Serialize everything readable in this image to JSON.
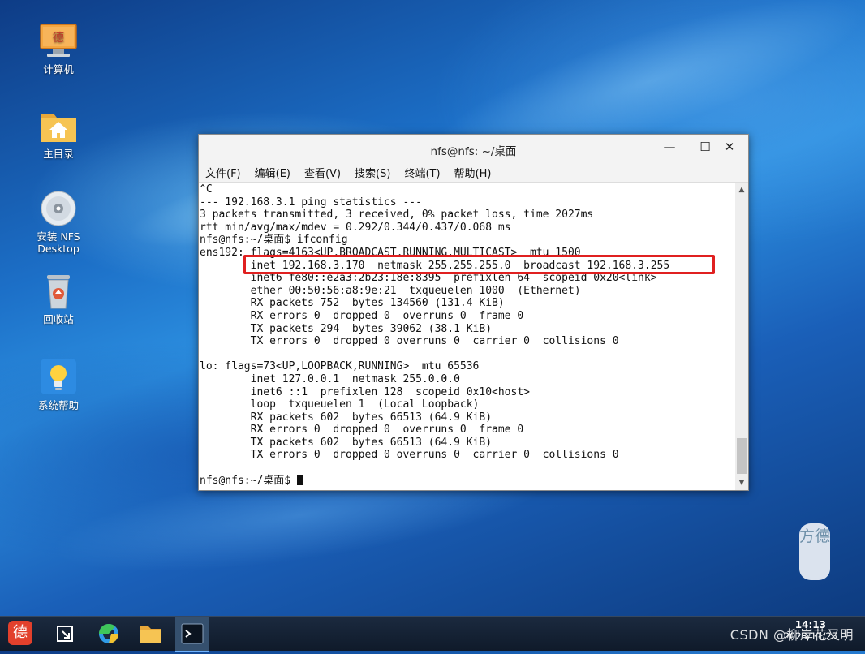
{
  "desktop": {
    "icons": [
      {
        "label": "计算机"
      },
      {
        "label": "主目录"
      },
      {
        "label": "安装 NFS Desktop"
      },
      {
        "label": "回收站"
      },
      {
        "label": "系统帮助"
      }
    ]
  },
  "window": {
    "title": "nfs@nfs: ~/桌面",
    "controls": {
      "minimize": "—",
      "maximize": "☐",
      "close": "✕"
    },
    "menu": [
      "文件(F)",
      "编辑(E)",
      "查看(V)",
      "搜索(S)",
      "终端(T)",
      "帮助(H)"
    ]
  },
  "terminal": {
    "lines": [
      "^C",
      "--- 192.168.3.1 ping statistics ---",
      "3 packets transmitted, 3 received, 0% packet loss, time 2027ms",
      "rtt min/avg/max/mdev = 0.292/0.344/0.437/0.068 ms",
      "nfs@nfs:~/桌面$ ifconfig",
      "ens192: flags=4163<UP,BROADCAST,RUNNING,MULTICAST>  mtu 1500",
      "        inet 192.168.3.170  netmask 255.255.255.0  broadcast 192.168.3.255",
      "        inet6 fe80::e2a3:2b23:18e:8395  prefixlen 64  scopeid 0x20<link>",
      "        ether 00:50:56:a8:9e:21  txqueuelen 1000  (Ethernet)",
      "        RX packets 752  bytes 134560 (131.4 KiB)",
      "        RX errors 0  dropped 0  overruns 0  frame 0",
      "        TX packets 294  bytes 39062 (38.1 KiB)",
      "        TX errors 0  dropped 0 overruns 0  carrier 0  collisions 0",
      "",
      "lo: flags=73<UP,LOOPBACK,RUNNING>  mtu 65536",
      "        inet 127.0.0.1  netmask 255.0.0.0",
      "        inet6 ::1  prefixlen 128  scopeid 0x10<host>",
      "        loop  txqueuelen 1  (Local Loopback)",
      "        RX packets 602  bytes 66513 (64.9 KiB)",
      "        RX errors 0  dropped 0  overruns 0  frame 0",
      "        TX packets 602  bytes 66513 (64.9 KiB)",
      "        TX errors 0  dropped 0 overruns 0  carrier 0  collisions 0",
      ""
    ],
    "prompt": "nfs@nfs:~/桌面$ ",
    "highlight_color": "#e02020"
  },
  "taskbar": {
    "start_label": "德",
    "clock_time": "14:13",
    "clock_date": "2023/11/25",
    "watermark": "CSDN @柳岸花又明"
  },
  "logo_text": "方德"
}
